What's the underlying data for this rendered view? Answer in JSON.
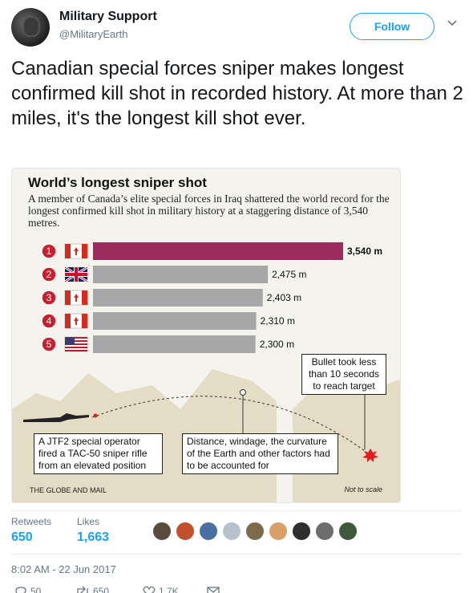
{
  "tweet": {
    "display_name": "Military Support",
    "handle": "@MilitaryEarth",
    "follow_label": "Follow",
    "text": "Canadian special forces sniper makes longest confirmed kill shot in recorded history. At more than 2 miles, it's the longest kill shot ever.",
    "retweets_label": "Retweets",
    "retweets_count": "650",
    "likes_label": "Likes",
    "likes_count": "1,663",
    "timestamp": "8:02 AM - 22 Jun 2017",
    "reply_count": "50",
    "retweet_action_count": "650",
    "like_action_count": "1.7K"
  },
  "infographic": {
    "title": "World’s longest sniper shot",
    "subtitle": "A member of Canada’s elite special forces in Iraq shattered the world record for the longest confirmed kill shot in military history at a staggering distance of 3,540 metres.",
    "note_bullet": "Bullet took less than 10 seconds to reach target",
    "note_jtf": "A JTF2 special operator fired a TAC-50 sniper rifle from an elevated position",
    "note_distance": "Distance, windage, the curvature of the Earth and other factors had to be accounted for",
    "source": "THE GLOBE AND MAIL",
    "scale_note": "Not to scale",
    "colors": {
      "highlight": "#9b2d5e",
      "bar": "#a7a7a7",
      "rank": "#c8202f",
      "background": "#f4f3ee",
      "mountain": "#e4dcc4"
    }
  },
  "chart_data": {
    "type": "bar",
    "orientation": "horizontal",
    "categories": [
      "1",
      "2",
      "3",
      "4",
      "5"
    ],
    "flags": [
      "canada",
      "united-kingdom",
      "canada",
      "canada",
      "united-states"
    ],
    "values": [
      3540,
      2475,
      2403,
      2310,
      2300
    ],
    "value_labels": [
      "3,540 m",
      "2,475 m",
      "2,403 m",
      "2,310 m",
      "2,300 m"
    ],
    "unit": "m",
    "title": "World’s longest sniper shot",
    "xlim": [
      0,
      3540
    ]
  }
}
